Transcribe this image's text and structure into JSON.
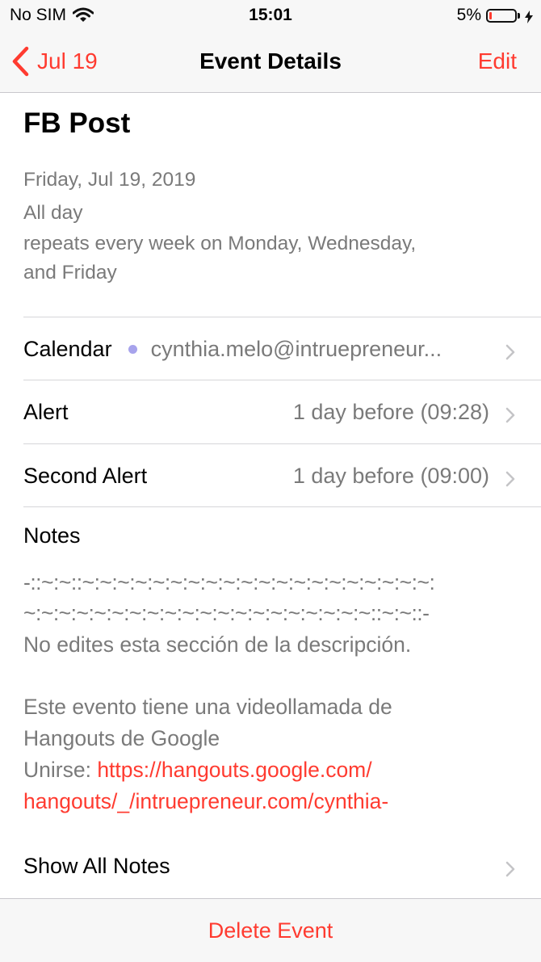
{
  "status_bar": {
    "carrier": "No SIM",
    "time": "15:01",
    "battery_percent": "5%",
    "battery_level": 0.05
  },
  "nav": {
    "back_label": "Jul 19",
    "title": "Event Details",
    "edit_label": "Edit"
  },
  "event": {
    "title": "FB Post",
    "date": "Friday, Jul 19, 2019",
    "time": "All day",
    "repeat_line1": "repeats every week on Monday, Wednesday,",
    "repeat_line2": "and Friday"
  },
  "rows": {
    "calendar": {
      "label": "Calendar",
      "value": "cynthia.melo@intruepreneur...",
      "dot_color": "#a7a3ec"
    },
    "alert": {
      "label": "Alert",
      "value": "1 day before (09:28)"
    },
    "second_alert": {
      "label": "Second Alert",
      "value": "1 day before (09:00)"
    }
  },
  "notes": {
    "label": "Notes",
    "line1": "-::~:~::~:~:~:~:~:~:~:~:~:~:~:~:~:~:~:~:~:~:~:~:",
    "line2": "~:~:~:~:~:~:~:~:~:~:~:~:~:~:~:~:~:~:~:~::~:~::-",
    "line3": "No edites esta sección de la descripción.",
    "line4": "Este evento tiene una videollamada de",
    "line5": "Hangouts de Google",
    "join_prefix": "Unirse: ",
    "link_line1": "https://hangouts.google.com/",
    "link_line2": "hangouts/_/intruepreneur.com/cynthia-",
    "show_all": "Show All Notes"
  },
  "bottom": {
    "delete_label": "Delete Event"
  },
  "colors": {
    "accent": "#ff3b30",
    "secondary_text": "#7a7a7a",
    "bar_background": "#f7f7f7"
  }
}
